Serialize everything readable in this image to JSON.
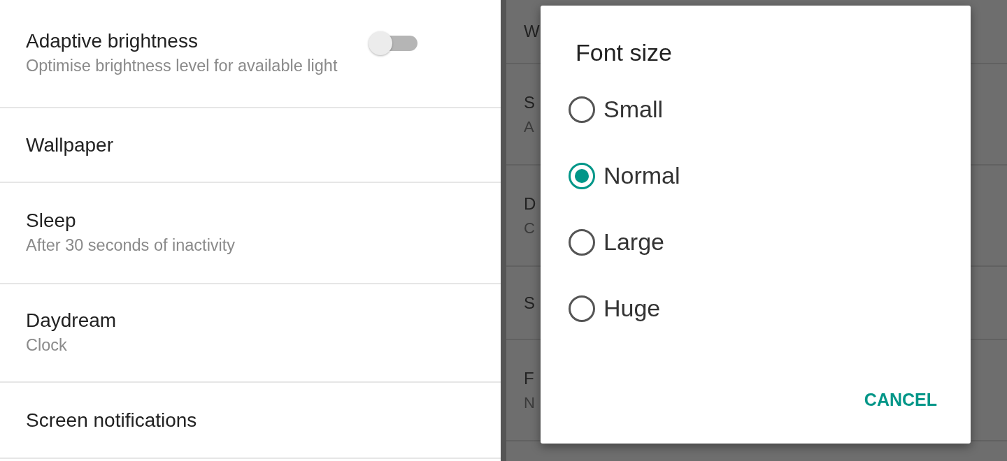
{
  "settings": [
    {
      "title": "Adaptive brightness",
      "subtitle": "Optimise brightness level for available light",
      "kind": "toggle",
      "on": false
    },
    {
      "title": "Wallpaper",
      "kind": "plain"
    },
    {
      "title": "Sleep",
      "subtitle": "After 30 seconds of inactivity",
      "kind": "plain"
    },
    {
      "title": "Daydream",
      "subtitle": "Clock",
      "kind": "plain"
    },
    {
      "title": "Screen notifications",
      "kind": "plain"
    }
  ],
  "background_list": [
    {
      "title": "W"
    },
    {
      "title": "S",
      "subtitle": "A"
    },
    {
      "title": "D",
      "subtitle": "C"
    },
    {
      "title": "S"
    },
    {
      "title": "F",
      "subtitle": "N"
    }
  ],
  "dialog": {
    "title": "Font size",
    "options": [
      {
        "label": "Small",
        "selected": false
      },
      {
        "label": "Normal",
        "selected": true
      },
      {
        "label": "Large",
        "selected": false
      },
      {
        "label": "Huge",
        "selected": false
      }
    ],
    "buttons": [
      "CANCEL"
    ]
  }
}
